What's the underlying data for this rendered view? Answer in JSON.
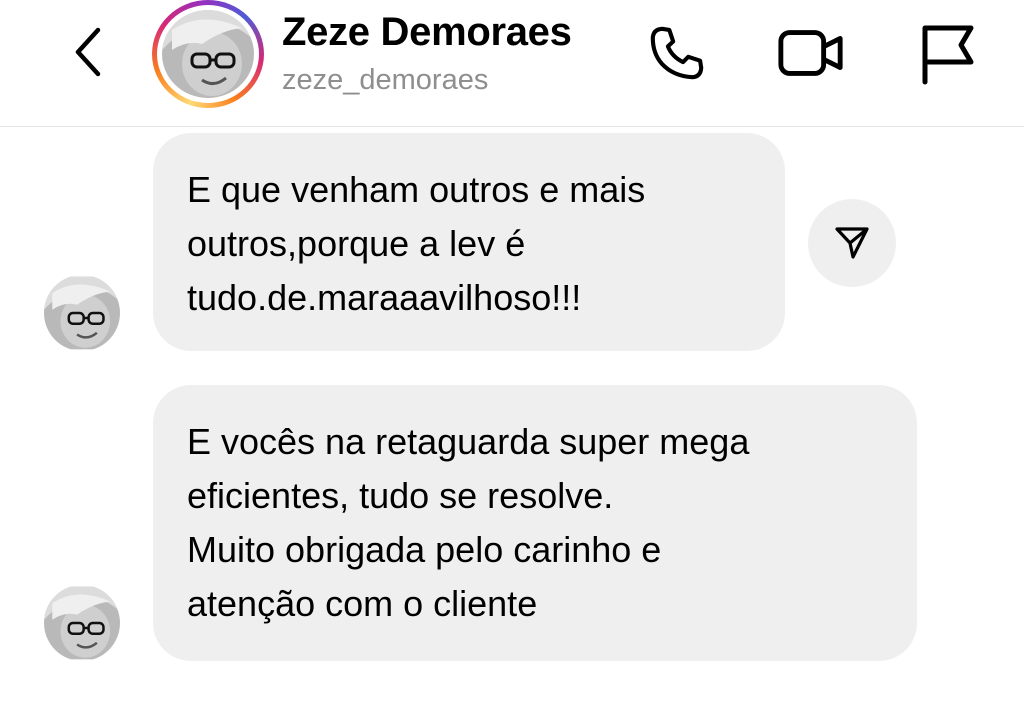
{
  "header": {
    "display_name": "Zeze Demoraes",
    "username": "zeze_demoraes",
    "back_icon": "chevron-left-icon",
    "call_icon": "phone-icon",
    "video_icon": "video-camera-icon",
    "report_icon": "flag-icon"
  },
  "colors": {
    "bubble": "#efefef",
    "secondary_text": "#8e8e8e",
    "divider": "#e6e6e6",
    "story_ring": [
      "#feda75",
      "#fa7e1e",
      "#d62976",
      "#962fbf",
      "#4f5bd5"
    ]
  },
  "messages": [
    {
      "lines": [
        "E que venham outros e mais",
        "outros,porque a lev é",
        "tudo.de.maraaavilhoso!!!"
      ],
      "share_icon": "paper-plane-icon"
    },
    {
      "lines": [
        "E vocês na retaguarda super mega",
        "eficientes, tudo se resolve.",
        "Muito obrigada pelo carinho e",
        "atenção com o cliente"
      ]
    }
  ]
}
